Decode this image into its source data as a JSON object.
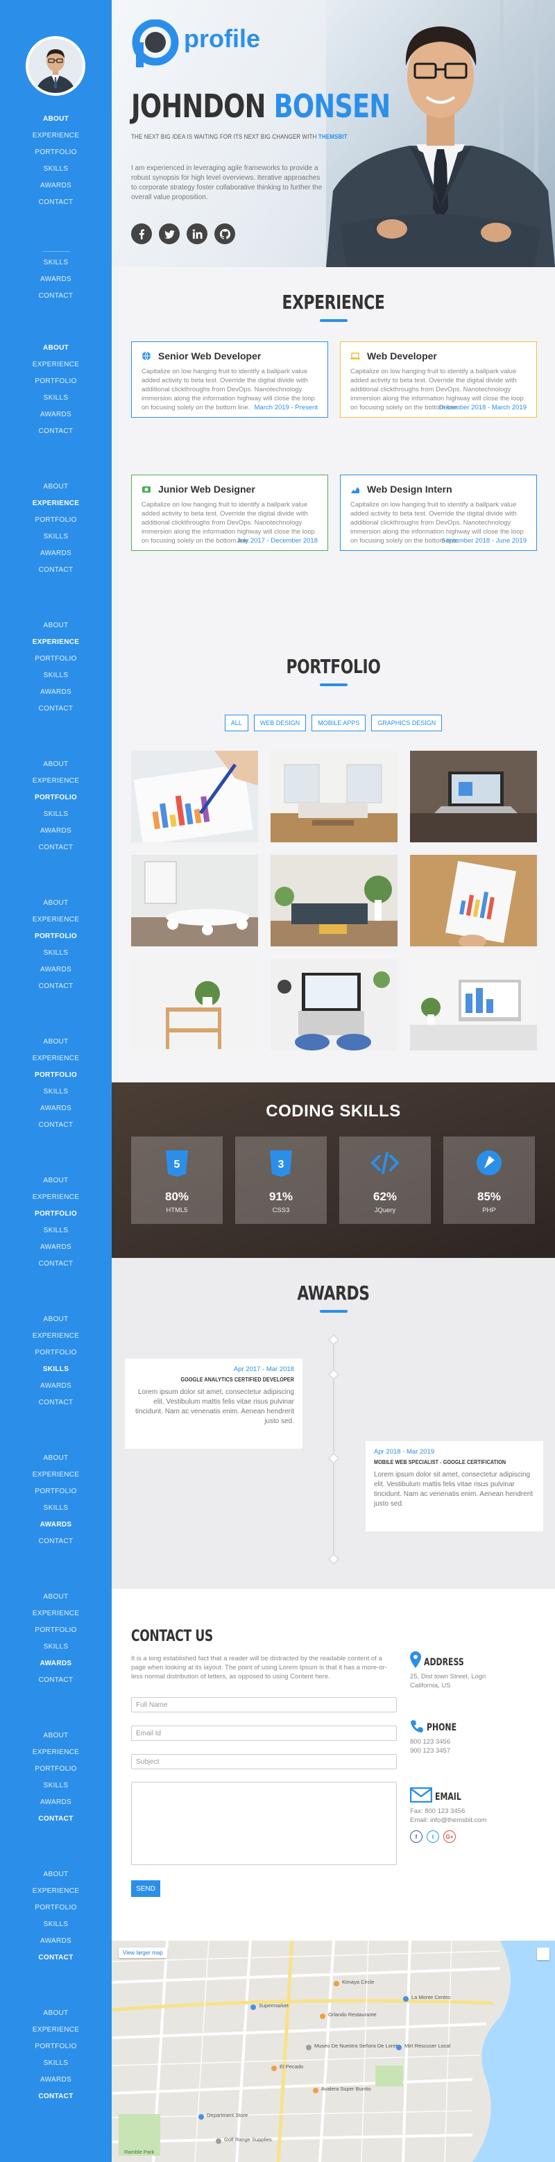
{
  "nav": {
    "groups": [
      {
        "items": [
          "ABOUT",
          "EXPERIENCE",
          "PORTFOLIO",
          "SKILLS",
          "AWARDS",
          "CONTACT"
        ],
        "active": 0
      },
      {
        "items": [
          "SKILLS",
          "AWARDS",
          "CONTACT"
        ],
        "active": -1
      },
      {
        "items": [
          "ABOUT",
          "EXPERIENCE",
          "PORTFOLIO",
          "SKILLS",
          "AWARDS",
          "CONTACT"
        ],
        "active": 0
      },
      {
        "items": [
          "ABOUT",
          "EXPERIENCE",
          "PORTFOLIO",
          "SKILLS",
          "AWARDS",
          "CONTACT"
        ],
        "active": 1
      },
      {
        "items": [
          "ABOUT",
          "EXPERIENCE",
          "PORTFOLIO",
          "SKILLS",
          "AWARDS",
          "CONTACT"
        ],
        "active": 1
      },
      {
        "items": [
          "ABOUT",
          "EXPERIENCE",
          "PORTFOLIO",
          "SKILLS",
          "AWARDS",
          "CONTACT"
        ],
        "active": 2
      },
      {
        "items": [
          "ABOUT",
          "EXPERIENCE",
          "PORTFOLIO",
          "SKILLS",
          "AWARDS",
          "CONTACT"
        ],
        "active": 2
      },
      {
        "items": [
          "ABOUT",
          "EXPERIENCE",
          "PORTFOLIO",
          "SKILLS",
          "AWARDS",
          "CONTACT"
        ],
        "active": 2
      },
      {
        "items": [
          "ABOUT",
          "EXPERIENCE",
          "PORTFOLIO",
          "SKILLS",
          "AWARDS",
          "CONTACT"
        ],
        "active": 2
      },
      {
        "items": [
          "ABOUT",
          "EXPERIENCE",
          "PORTFOLIO",
          "SKILLS",
          "AWARDS",
          "CONTACT"
        ],
        "active": 3
      },
      {
        "items": [
          "ABOUT",
          "EXPERIENCE",
          "PORTFOLIO",
          "SKILLS",
          "AWARDS",
          "CONTACT"
        ],
        "active": 4
      },
      {
        "items": [
          "ABOUT",
          "EXPERIENCE",
          "PORTFOLIO",
          "SKILLS",
          "AWARDS",
          "CONTACT"
        ],
        "active": 4
      },
      {
        "items": [
          "ABOUT",
          "EXPERIENCE",
          "PORTFOLIO",
          "SKILLS",
          "AWARDS",
          "CONTACT"
        ],
        "active": 5
      },
      {
        "items": [
          "ABOUT",
          "EXPERIENCE",
          "PORTFOLIO",
          "SKILLS",
          "AWARDS",
          "CONTACT"
        ],
        "active": 5
      },
      {
        "items": [
          "ABOUT",
          "EXPERIENCE",
          "PORTFOLIO",
          "SKILLS",
          "AWARDS",
          "CONTACT"
        ],
        "active": 5
      }
    ]
  },
  "hero": {
    "logo_text": "profile",
    "first_name": "JOHNDON",
    "last_name": "BONSEN",
    "tagline_prefix": "THE NEXT BIG IDEA IS WAITING FOR ITS NEXT BIG CHANGER WITH",
    "tagline_brand": "THEMSBIT",
    "bio": "I am experienced in leveraging agile frameworks to provide a robust synopsis for high level overviews. Iterative approaches to corporate strategy foster collaborative thinking to further the overall value proposition.",
    "socials": [
      "facebook-icon",
      "twitter-icon",
      "linkedin-icon",
      "github-icon"
    ]
  },
  "experience": {
    "title": "EXPERIENCE",
    "jobs": [
      {
        "title": "Senior Web Developer",
        "icon": "globe-icon",
        "color": "#2b8fe9",
        "date": "March 2019 - Present",
        "desc": "Capitalize on low hanging fruit to identify a ballpark value added activity to beta test. Override the digital divide with additional clickthroughs from DevOps. Nanotechnology immersion along the information highway will close the loop on focusing solely on the bottom line."
      },
      {
        "title": "Web Developer",
        "icon": "laptop-icon",
        "color": "#f0c040",
        "date": "December 2018 - March 2019",
        "desc": "Capitalize on low hanging fruit to identify a ballpark value added activity to beta test. Override the digital divide with additional clickthroughs from DevOps. Nanotechnology immersion along the information highway will close the loop on focusing solely on the bottom line."
      },
      {
        "title": "Junior Web Designer",
        "icon": "camera-icon",
        "color": "#4caf50",
        "date": "July 2017 - December 2018",
        "desc": "Capitalize on low hanging fruit to identify a ballpark value added activity to beta test. Override the digital divide with additional clickthroughs from DevOps. Nanotechnology immersion along the information highway will close the loop on focusing solely on the bottom line."
      },
      {
        "title": "Web Design Intern",
        "icon": "chart-icon",
        "color": "#2b8fe9",
        "date": "September 2018 - June 2019",
        "desc": "Capitalize on low hanging fruit to identify a ballpark value added activity to beta test. Override the digital divide with additional clickthroughs from DevOps. Nanotechnology immersion along the information highway will close the loop on focusing solely on the bottom line."
      }
    ]
  },
  "portfolio": {
    "title": "PORTFOLIO",
    "filters": [
      "ALL",
      "WEB DESIGN",
      "MOBILE APPS",
      "GRAPHICS DESIGN"
    ],
    "tiles": [
      "charts-on-paper",
      "white-living-room",
      "laptop-on-desk",
      "meeting-room",
      "living-room-plants",
      "chart-printout",
      "shelf-with-plant",
      "laptop-from-above",
      "imac-workspace"
    ]
  },
  "skills": {
    "title": "CODING SKILLS",
    "items": [
      {
        "pct": "80%",
        "name": "HTML5",
        "icon": "html5-icon",
        "value": 80
      },
      {
        "pct": "91%",
        "name": "CSS3",
        "icon": "css3-icon",
        "value": 91
      },
      {
        "pct": "62%",
        "name": "JQuery",
        "icon": "code-icon",
        "value": 62
      },
      {
        "pct": "85%",
        "name": "PHP",
        "icon": "php-icon",
        "value": 85
      }
    ]
  },
  "awards": {
    "title": "AWARDS",
    "items": [
      {
        "date": "Apr 2017 - Mar 2018",
        "title": "GOOGLE ANALYTICS CERTIFIED DEVELOPER",
        "desc": "Lorem ipsum dolor sit amet, consectetur adipiscing elit. Vestibulum mattis felis vitae risus pulvinar tincidunt. Nam ac venenatis enim. Aenean hendrerit justo sed."
      },
      {
        "date": "Apr 2018 - Mar 2019",
        "title": "MOBILE WEB SPECIALIST - GOOGLE CERTIFICATION",
        "desc": "Lorem ipsum dolor sit amet, consectetur adipiscing elit. Vestibulum mattis felis vitae risus pulvinar tincidunt. Nam ac venenatis enim. Aenean hendrerit justo sed."
      }
    ]
  },
  "contact": {
    "title": "CONTACT US",
    "intro": "It is a long established fact that a reader will be distracted by the readable content of a page when looking at its layout. The point of using Lorem Ipsum is that it has a more-or-less normal distribution of letters, as opposed to using Content here.",
    "placeholders": {
      "name": "Full Name",
      "email": "Email Id",
      "subject": "Subject",
      "message": ""
    },
    "send": "SEND",
    "address_label": "ADDRESS",
    "address_lines": [
      "25, Dist town Street, Logn",
      "California, US"
    ],
    "phone_label": "PHONE",
    "phone_lines": [
      "800 123 3456",
      "900 123 3457"
    ],
    "email_label": "EMAIL",
    "email_lines": [
      "Fax: 800 123 3456",
      "Email: info@themsbit.com"
    ],
    "socials": [
      {
        "icon": "facebook-icon",
        "glyph": "f",
        "color": "#3b5998"
      },
      {
        "icon": "twitter-icon",
        "glyph": "t",
        "color": "#1da1f2"
      },
      {
        "icon": "google-plus-icon",
        "glyph": "G+",
        "color": "#dd4b39"
      }
    ]
  },
  "map": {
    "view_larger": "View larger map",
    "labels": [
      "Kimaya Circle",
      "La Monte Centro",
      "Orlando Restaurante",
      "Supermarket",
      "Museo De Nuestra Señora De Loreto",
      "Mirt Rescuser Local",
      "El Pecado",
      "Avalera Super Burrito",
      "Department Store",
      "Golf Range Supplies",
      "Ramble Park"
    ]
  }
}
